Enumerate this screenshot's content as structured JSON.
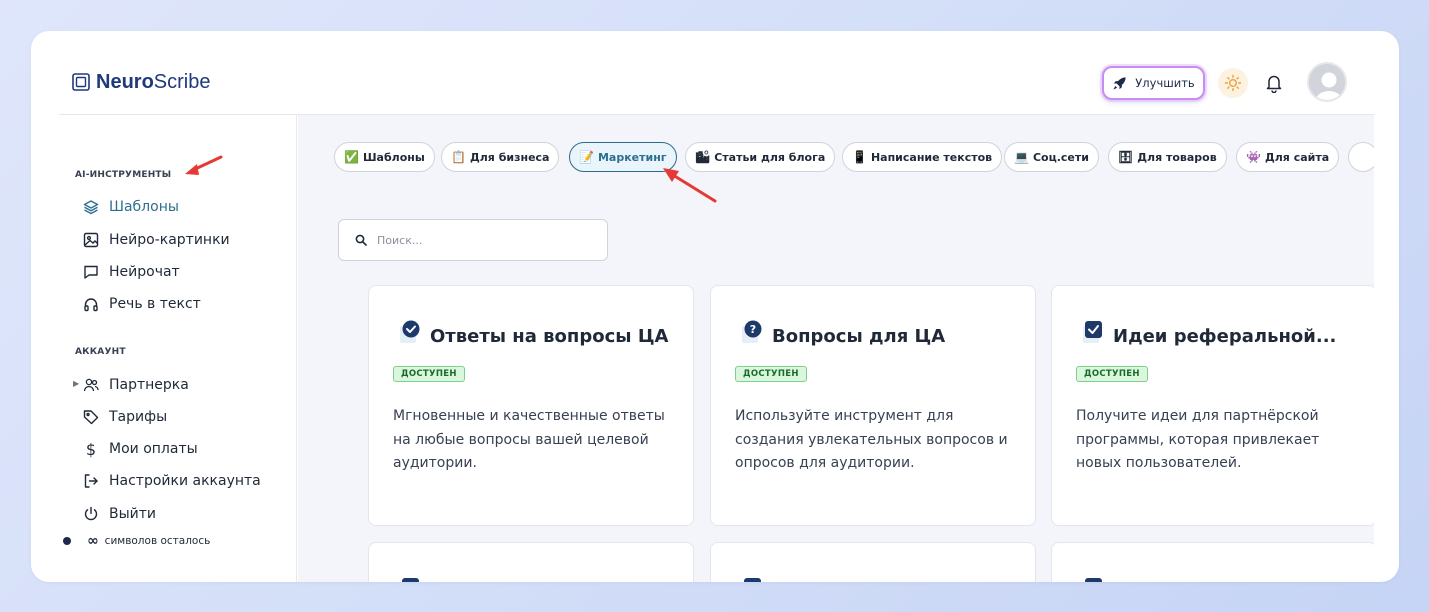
{
  "brand": {
    "bold": "Neuro",
    "light": "Scribe"
  },
  "header": {
    "upgrade_label": "Улучшить"
  },
  "sidebar": {
    "sections": [
      {
        "title": "AI-ИНСТРУМЕНТЫ",
        "items": [
          {
            "label": "Шаблоны",
            "icon": "layers-icon",
            "active": true
          },
          {
            "label": "Нейро-картинки",
            "icon": "image-icon"
          },
          {
            "label": "Нейрочат",
            "icon": "chat-icon"
          },
          {
            "label": "Речь в текст",
            "icon": "headphones-icon"
          }
        ]
      },
      {
        "title": "АККАУНТ",
        "items": [
          {
            "label": "Партнерка",
            "icon": "users-icon"
          },
          {
            "label": "Тарифы",
            "icon": "tag-icon"
          },
          {
            "label": "Мои оплаты",
            "icon": "dollar-icon"
          },
          {
            "label": "Настройки аккаунта",
            "icon": "logout-arrow-icon"
          },
          {
            "label": "Выйти",
            "icon": "power-icon"
          }
        ]
      }
    ],
    "credits": {
      "symbol": "∞",
      "label": "символов осталось"
    }
  },
  "categories": [
    {
      "emoji": "✅",
      "label": "Шаблоны"
    },
    {
      "emoji": "📋",
      "label": "Для бизнеса"
    },
    {
      "emoji": "📝",
      "label": "Маркетинг",
      "active": true
    },
    {
      "emoji": "🏙",
      "label": "Статьи для блога"
    },
    {
      "emoji": "📱",
      "label": "Написание текстов"
    },
    {
      "emoji": "💻",
      "label": "Соц.сети"
    },
    {
      "emoji": "🗄",
      "label": "Для товаров"
    },
    {
      "emoji": "👾",
      "label": "Для сайта"
    }
  ],
  "search": {
    "placeholder": "Поиск..."
  },
  "cards": [
    {
      "icon": "check-circle-icon",
      "title": "Ответы на вопросы ЦА",
      "badge": "ДОСТУПЕН",
      "description": "Мгновенные и качественные ответы на любые вопросы вашей целевой аудитории."
    },
    {
      "icon": "question-circle-icon",
      "title": "Вопросы для ЦА",
      "badge": "ДОСТУПЕН",
      "description": "Используйте инструмент для создания увлекательных вопросов и опросов для аудитории."
    },
    {
      "icon": "check-box-icon",
      "title": "Идеи реферальной...",
      "badge": "ДОСТУПЕН",
      "description": "Получите идеи для партнёрской программы, которая привлекает новых пользователей."
    }
  ],
  "colors": {
    "accent": "#2c6f8f",
    "badge_bg": "#d9f7dc",
    "badge_text": "#1b6b28",
    "arrow": "#e53935"
  }
}
